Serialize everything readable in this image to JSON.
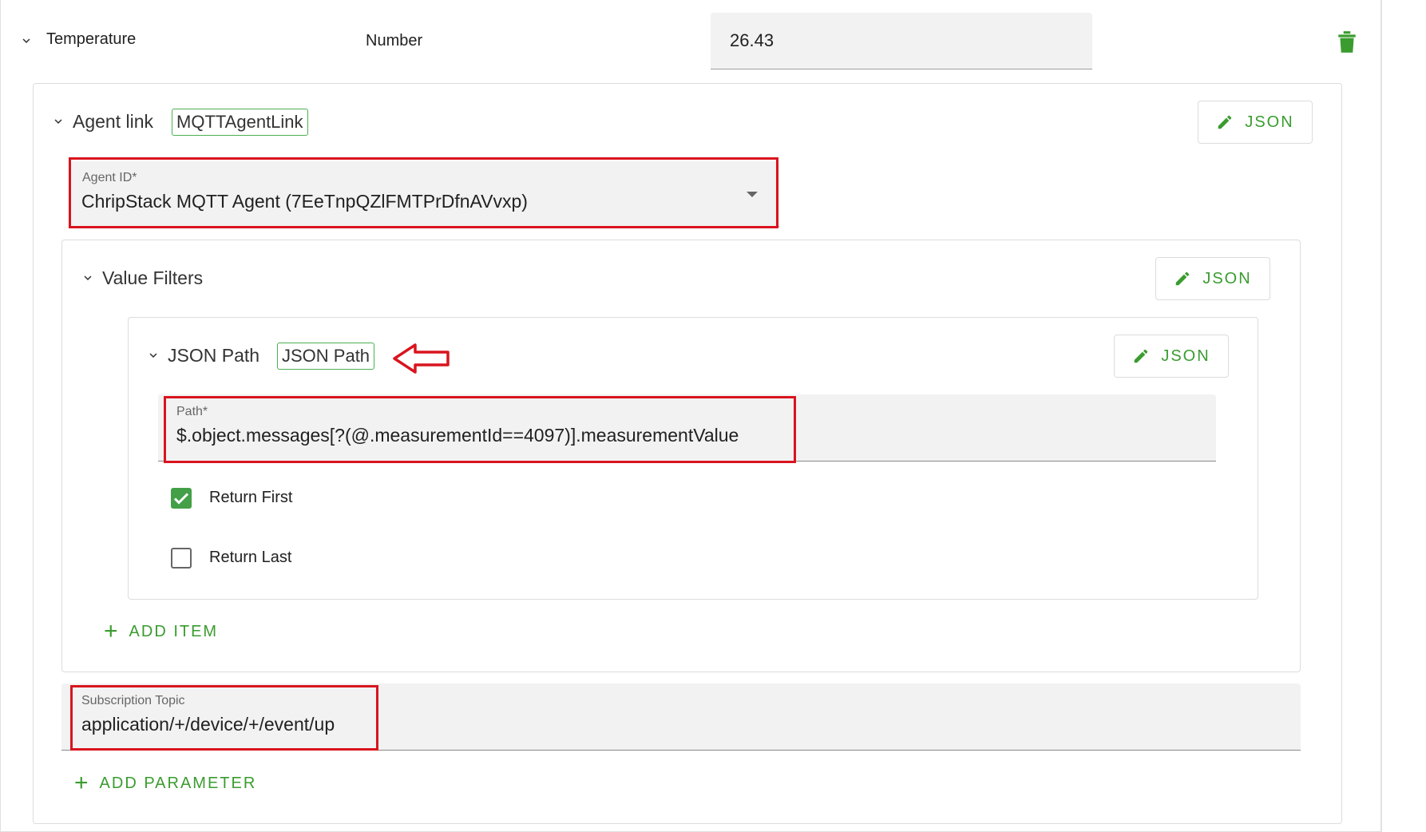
{
  "attribute": {
    "name": "Temperature",
    "type": "Number",
    "value": "26.43",
    "delete_icon": "trash-icon",
    "accent_color": "#3a9c2f"
  },
  "agent_link": {
    "label": "Agent link",
    "chip": "MQTTAgentLink",
    "json_button": "JSON",
    "agent_id": {
      "label": "Agent ID*",
      "value": "ChripStack MQTT Agent (7EeTnpQZlFMTPrDfnAVvxp)"
    },
    "value_filters": {
      "label": "Value Filters",
      "json_button": "JSON",
      "json_path": {
        "label": "JSON Path",
        "chip": "JSON Path",
        "json_button": "JSON",
        "path": {
          "label": "Path*",
          "value": "$.object.messages[?(@.measurementId==4097)].measurementValue"
        },
        "return_first": {
          "label": "Return First",
          "checked": true
        },
        "return_last": {
          "label": "Return Last",
          "checked": false
        }
      },
      "add_item": "ADD ITEM"
    },
    "subscription_topic": {
      "label": "Subscription Topic",
      "value": "application/+/device/+/event/up"
    },
    "add_parameter": "ADD PARAMETER"
  },
  "annotation_color": "#d9141e"
}
